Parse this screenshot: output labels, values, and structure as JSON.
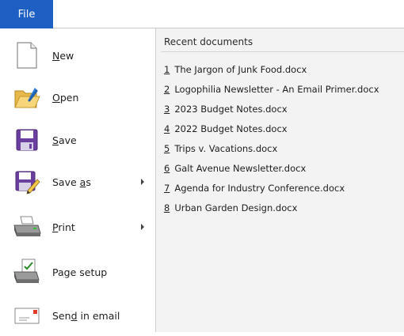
{
  "file_tab": {
    "label": "File"
  },
  "menu": [
    {
      "id": "new",
      "label_pre": "",
      "label_key": "N",
      "label_post": "ew",
      "icon": "new-document-icon",
      "has_submenu": false
    },
    {
      "id": "open",
      "label_pre": "",
      "label_key": "O",
      "label_post": "pen",
      "icon": "open-folder-icon",
      "has_submenu": false
    },
    {
      "id": "save",
      "label_pre": "",
      "label_key": "S",
      "label_post": "ave",
      "icon": "floppy-disk-icon",
      "has_submenu": false
    },
    {
      "id": "save-as",
      "label_pre": "Save ",
      "label_key": "a",
      "label_post": "s",
      "icon": "save-as-icon",
      "has_submenu": true
    },
    {
      "id": "print",
      "label_pre": "",
      "label_key": "P",
      "label_post": "rint",
      "icon": "printer-icon",
      "has_submenu": true
    },
    {
      "id": "page-setup",
      "label_pre": "Pa",
      "label_key": "g",
      "label_post": "e setup",
      "icon": "page-setup-icon",
      "has_submenu": false
    },
    {
      "id": "send-in-email",
      "label_pre": "Sen",
      "label_key": "d",
      "label_post": " in email",
      "icon": "email-envelope-icon",
      "has_submenu": false
    }
  ],
  "recent": {
    "title": "Recent documents",
    "items": [
      {
        "num": "1",
        "name": "The Jargon of Junk Food.docx"
      },
      {
        "num": "2",
        "name": "Logophilia Newsletter - An Email Primer.docx"
      },
      {
        "num": "3",
        "name": "2023 Budget Notes.docx"
      },
      {
        "num": "4",
        "name": "2022 Budget Notes.docx"
      },
      {
        "num": "5",
        "name": "Trips v. Vacations.docx"
      },
      {
        "num": "6",
        "name": "Galt Avenue Newsletter.docx"
      },
      {
        "num": "7",
        "name": "Agenda for Industry Conference.docx"
      },
      {
        "num": "8",
        "name": "Urban Garden Design.docx"
      }
    ]
  },
  "colors": {
    "accent": "#1e5fc4",
    "pane_bg": "#f3f3f3"
  }
}
